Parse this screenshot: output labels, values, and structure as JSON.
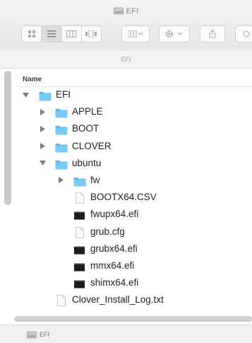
{
  "window": {
    "title": "EFI",
    "path_title": "EFI"
  },
  "toolbar": {
    "view_icons": [
      "icon-view-icon",
      "list-view-icon",
      "column-view-icon",
      "cover-flow-icon"
    ],
    "arrange_icon": "arrange-grid-icon",
    "action_icon": "gear-icon",
    "share_icon": "share-icon"
  },
  "columns": {
    "name": "Name"
  },
  "tree": [
    {
      "name": "EFI",
      "type": "folder",
      "level": 0,
      "expanded": true
    },
    {
      "name": "APPLE",
      "type": "folder",
      "level": 1,
      "expanded": false
    },
    {
      "name": "BOOT",
      "type": "folder",
      "level": 1,
      "expanded": false
    },
    {
      "name": "CLOVER",
      "type": "folder",
      "level": 1,
      "expanded": false
    },
    {
      "name": "ubuntu",
      "type": "folder",
      "level": 1,
      "expanded": true
    },
    {
      "name": "fw",
      "type": "folder",
      "level": 2,
      "expanded": false
    },
    {
      "name": "BOOTX64.CSV",
      "type": "document",
      "level": 2
    },
    {
      "name": "fwupx64.efi",
      "type": "executable",
      "level": 2
    },
    {
      "name": "grub.cfg",
      "type": "document",
      "level": 2
    },
    {
      "name": "grubx64.efi",
      "type": "executable",
      "level": 2
    },
    {
      "name": "mmx64.efi",
      "type": "executable",
      "level": 2
    },
    {
      "name": "shimx64.efi",
      "type": "executable",
      "level": 2
    },
    {
      "name": "Clover_Install_Log.txt",
      "type": "document",
      "level": 1
    }
  ],
  "status": {
    "label": "EFI"
  },
  "colors": {
    "folder": "#5ab7f2",
    "folder_tab": "#79c8f6",
    "executable": "#1c1c1c",
    "disclosure": "#7c7c7c",
    "accent": "#5ab7f2"
  }
}
